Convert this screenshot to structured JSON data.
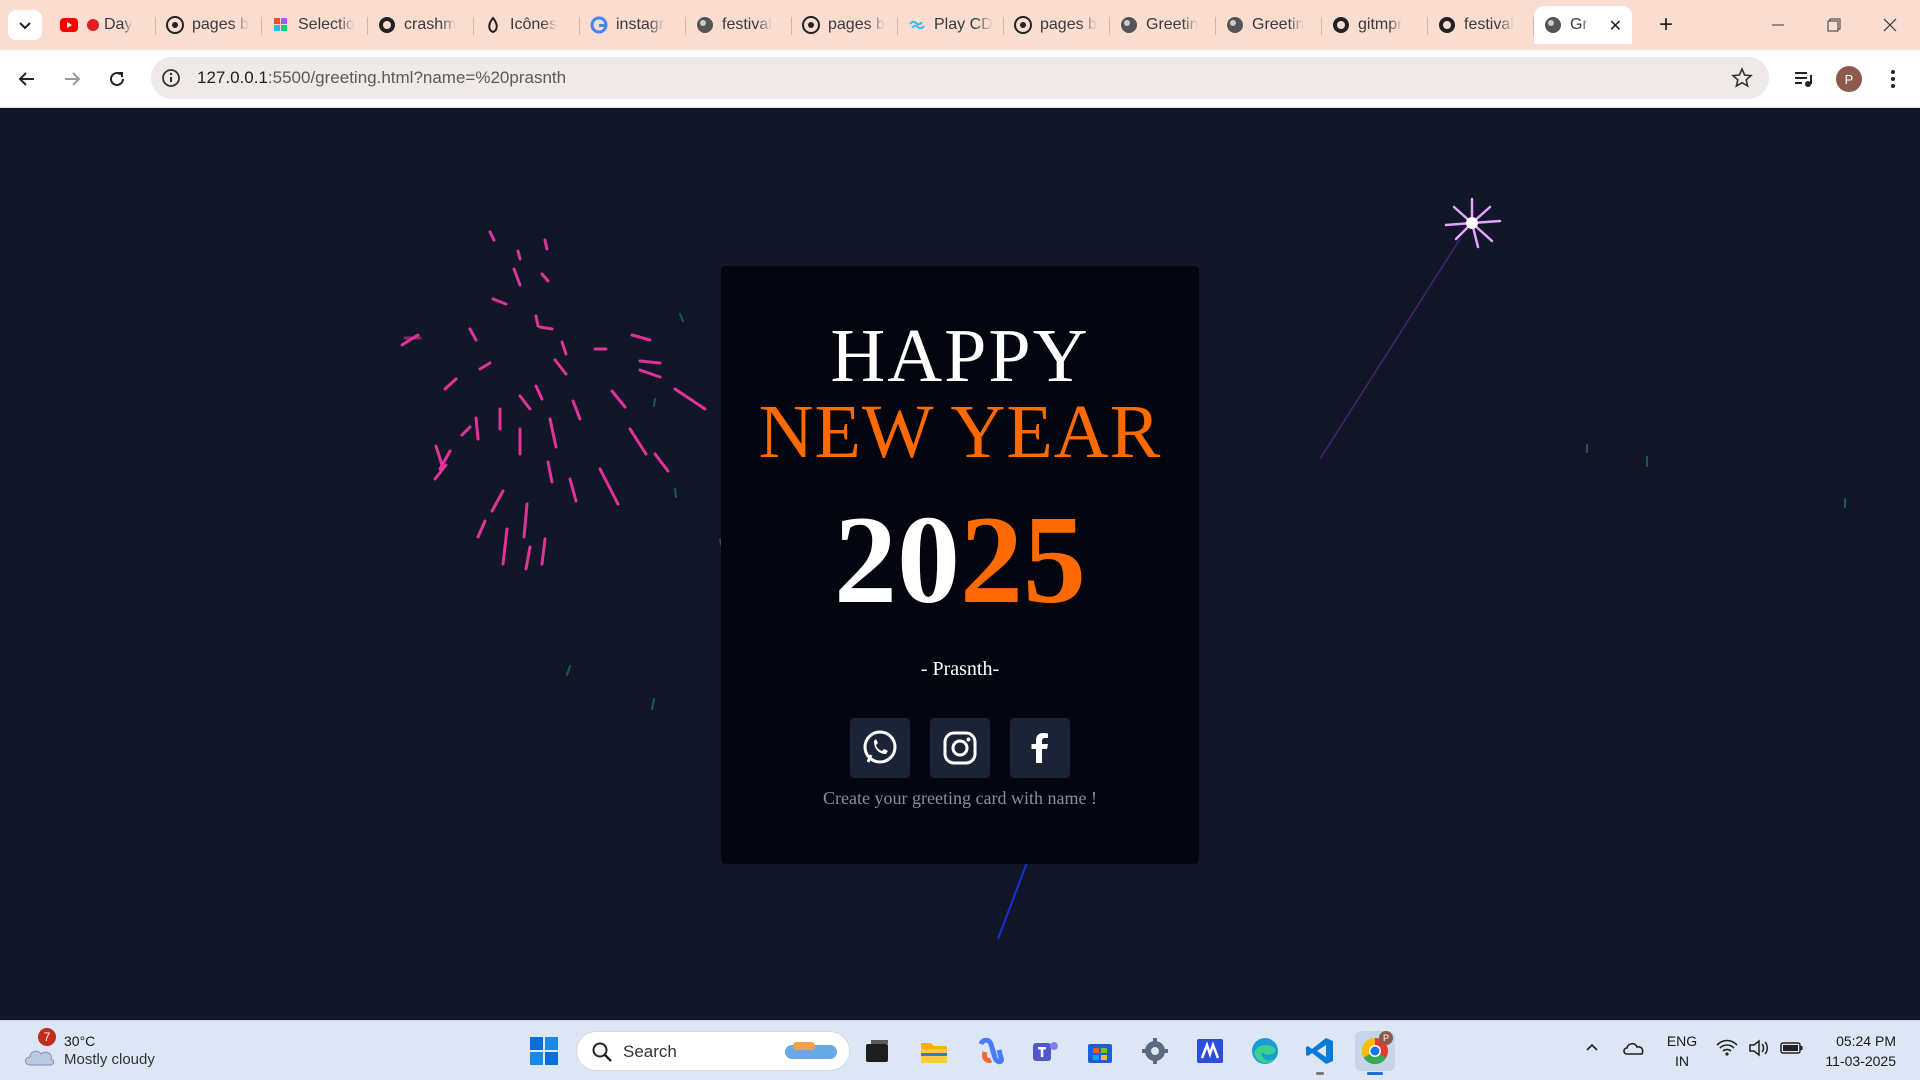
{
  "browser": {
    "tabs": [
      {
        "title": "Day",
        "icon": "youtube-icon"
      },
      {
        "title": "pages b",
        "icon": "github-copilot-icon"
      },
      {
        "title": "Selectio",
        "icon": "figma-icon"
      },
      {
        "title": "crashm",
        "icon": "github-icon"
      },
      {
        "title": "Icônes",
        "icon": "icones-icon"
      },
      {
        "title": "instagr",
        "icon": "google-icon"
      },
      {
        "title": "festival",
        "icon": "globe-icon"
      },
      {
        "title": "pages b",
        "icon": "github-copilot-icon"
      },
      {
        "title": "Play CD",
        "icon": "tailwind-icon"
      },
      {
        "title": "pages b",
        "icon": "github-copilot-icon"
      },
      {
        "title": "Greetin",
        "icon": "globe-icon"
      },
      {
        "title": "Greetin",
        "icon": "globe-icon"
      },
      {
        "title": "gitmpr",
        "icon": "github-icon"
      },
      {
        "title": "festival",
        "icon": "github-icon"
      }
    ],
    "active_tab": {
      "title": "Gr",
      "icon": "globe-icon"
    },
    "url_host": "127.0.0.1",
    "url_path": ":5500/greeting.html?name=%20prasnth",
    "profile_initial": "P"
  },
  "card": {
    "line1": "HAPPY",
    "line2": "NEW YEAR",
    "year_white": "20",
    "year_orange": "25",
    "name": "- Prasnth-",
    "cta": "Create your greeting card with name !",
    "accent": "#ff6a00",
    "socials": [
      "whatsapp-icon",
      "instagram-icon",
      "facebook-icon"
    ]
  },
  "taskbar": {
    "weather_badge": "7",
    "temperature": "30°C",
    "condition": "Mostly cloudy",
    "search_label": "Search",
    "lang_top": "ENG",
    "lang_bottom": "IN",
    "time": "05:24 PM",
    "date": "11-03-2025"
  }
}
